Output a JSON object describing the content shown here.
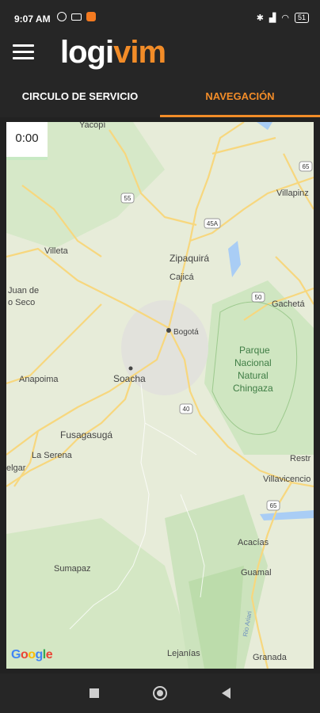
{
  "status": {
    "time": "9:07 AM",
    "battery": "51"
  },
  "app": {
    "logo_part1": "logi",
    "logo_part2": "vim"
  },
  "tabs": [
    {
      "label": "CIRCULO DE SERVICIO",
      "active": false
    },
    {
      "label": "NAVEGACIÓN",
      "active": true
    }
  ],
  "map": {
    "timer": "0:00",
    "attribution": "Google",
    "places": [
      {
        "name": "Yacopí"
      },
      {
        "name": "Villeta"
      },
      {
        "name": "Juan de"
      },
      {
        "name": "o Seco"
      },
      {
        "name": "Zipaquirá"
      },
      {
        "name": "Cajicá"
      },
      {
        "name": "Bogotá"
      },
      {
        "name": "Gachetá"
      },
      {
        "name": "Villapinz"
      },
      {
        "name": "Parque"
      },
      {
        "name": "Nacional"
      },
      {
        "name": "Natural"
      },
      {
        "name": "Chingaza"
      },
      {
        "name": "Anapoima"
      },
      {
        "name": "Soacha"
      },
      {
        "name": "Fusagasugá"
      },
      {
        "name": "La Serena"
      },
      {
        "name": "elgar"
      },
      {
        "name": "Restr"
      },
      {
        "name": "Villavicencio"
      },
      {
        "name": "Sumapaz"
      },
      {
        "name": "Acacías"
      },
      {
        "name": "Guamal"
      },
      {
        "name": "Lejanías"
      },
      {
        "name": "Granada"
      },
      {
        "name": "Rio Ariari"
      }
    ],
    "route_shields": [
      "55",
      "45A",
      "50",
      "40",
      "65",
      "65"
    ],
    "colors": {
      "road": "#f7d77e",
      "park": "#cfe6c1",
      "water": "#a9cdf5",
      "background": "#e7ecd9",
      "accent": "#f28c28"
    }
  }
}
